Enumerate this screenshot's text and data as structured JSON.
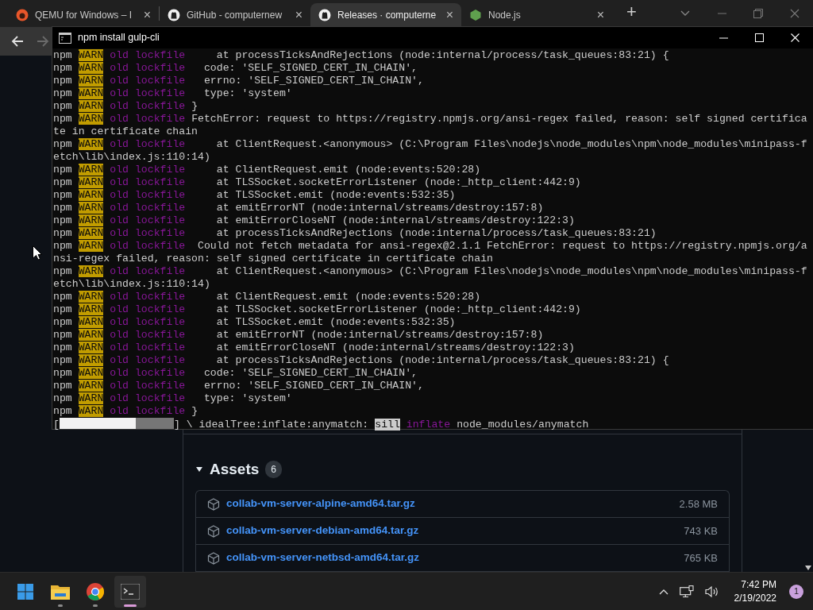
{
  "browser": {
    "tabs": [
      {
        "kind": "qemu",
        "title": "QEMU for Windows – I",
        "close": "×",
        "selected": false
      },
      {
        "kind": "github",
        "title": "GitHub - computernew",
        "close": "×",
        "selected": false
      },
      {
        "kind": "github",
        "title": "Releases · computerne",
        "close": "×",
        "selected": true
      },
      {
        "kind": "node",
        "title": "Node.js",
        "close": "×",
        "selected": false
      }
    ],
    "new_tab": "+",
    "nav_buttons": [
      {
        "kind": "back",
        "disabled": false
      },
      {
        "kind": "forward",
        "disabled": true
      }
    ]
  },
  "page": {
    "assets": {
      "title": "Assets",
      "count": "6",
      "expanded": true,
      "files": [
        {
          "name": "collab-vm-server-alpine-amd64.tar.gz",
          "size": "2.58 MB"
        },
        {
          "name": "collab-vm-server-debian-amd64.tar.gz",
          "size": "743 KB"
        },
        {
          "name": "collab-vm-server-netbsd-amd64.tar.gz",
          "size": "765 KB"
        }
      ]
    }
  },
  "terminal": {
    "title": "npm install gulp-cli",
    "lines": [
      {
        "kind": "warn",
        "tool": "npm",
        "level": "WARN",
        "tag": "old lockfile",
        "text": "     at processTicksAndRejections (node:internal/process/task_queues:83:21) {"
      },
      {
        "kind": "warn",
        "tool": "npm",
        "level": "WARN",
        "tag": "old lockfile",
        "text": "   code: 'SELF_SIGNED_CERT_IN_CHAIN',"
      },
      {
        "kind": "warn",
        "tool": "npm",
        "level": "WARN",
        "tag": "old lockfile",
        "text": "   errno: 'SELF_SIGNED_CERT_IN_CHAIN',"
      },
      {
        "kind": "warn",
        "tool": "npm",
        "level": "WARN",
        "tag": "old lockfile",
        "text": "   type: 'system'"
      },
      {
        "kind": "warn",
        "tool": "npm",
        "level": "WARN",
        "tag": "old lockfile",
        "text": " }"
      },
      {
        "kind": "warn",
        "tool": "npm",
        "level": "WARN",
        "tag": "old lockfile",
        "text": " FetchError: request to https://registry.npmjs.org/ansi-regex failed, reason: self signed certifica"
      },
      {
        "kind": "plain",
        "text": "te in certificate chain"
      },
      {
        "kind": "warn",
        "tool": "npm",
        "level": "WARN",
        "tag": "old lockfile",
        "text": "     at ClientRequest.<anonymous> (C:\\Program Files\\nodejs\\node_modules\\npm\\node_modules\\minipass-f"
      },
      {
        "kind": "plain",
        "text": "etch\\lib\\index.js:110:14)"
      },
      {
        "kind": "warn",
        "tool": "npm",
        "level": "WARN",
        "tag": "old lockfile",
        "text": "     at ClientRequest.emit (node:events:520:28)"
      },
      {
        "kind": "warn",
        "tool": "npm",
        "level": "WARN",
        "tag": "old lockfile",
        "text": "     at TLSSocket.socketErrorListener (node:_http_client:442:9)"
      },
      {
        "kind": "warn",
        "tool": "npm",
        "level": "WARN",
        "tag": "old lockfile",
        "text": "     at TLSSocket.emit (node:events:532:35)"
      },
      {
        "kind": "warn",
        "tool": "npm",
        "level": "WARN",
        "tag": "old lockfile",
        "text": "     at emitErrorNT (node:internal/streams/destroy:157:8)"
      },
      {
        "kind": "warn",
        "tool": "npm",
        "level": "WARN",
        "tag": "old lockfile",
        "text": "     at emitErrorCloseNT (node:internal/streams/destroy:122:3)"
      },
      {
        "kind": "warn",
        "tool": "npm",
        "level": "WARN",
        "tag": "old lockfile",
        "text": "     at processTicksAndRejections (node:internal/process/task_queues:83:21)"
      },
      {
        "kind": "warn",
        "tool": "npm",
        "level": "WARN",
        "tag": "old lockfile",
        "text": "  Could not fetch metadata for ansi-regex@2.1.1 FetchError: request to https://registry.npmjs.org/a"
      },
      {
        "kind": "plain",
        "text": "nsi-regex failed, reason: self signed certificate in certificate chain"
      },
      {
        "kind": "warn",
        "tool": "npm",
        "level": "WARN",
        "tag": "old lockfile",
        "text": "     at ClientRequest.<anonymous> (C:\\Program Files\\nodejs\\node_modules\\npm\\node_modules\\minipass-f"
      },
      {
        "kind": "plain",
        "text": "etch\\lib\\index.js:110:14)"
      },
      {
        "kind": "warn",
        "tool": "npm",
        "level": "WARN",
        "tag": "old lockfile",
        "text": "     at ClientRequest.emit (node:events:520:28)"
      },
      {
        "kind": "warn",
        "tool": "npm",
        "level": "WARN",
        "tag": "old lockfile",
        "text": "     at TLSSocket.socketErrorListener (node:_http_client:442:9)"
      },
      {
        "kind": "warn",
        "tool": "npm",
        "level": "WARN",
        "tag": "old lockfile",
        "text": "     at TLSSocket.emit (node:events:532:35)"
      },
      {
        "kind": "warn",
        "tool": "npm",
        "level": "WARN",
        "tag": "old lockfile",
        "text": "     at emitErrorNT (node:internal/streams/destroy:157:8)"
      },
      {
        "kind": "warn",
        "tool": "npm",
        "level": "WARN",
        "tag": "old lockfile",
        "text": "     at emitErrorCloseNT (node:internal/streams/destroy:122:3)"
      },
      {
        "kind": "warn",
        "tool": "npm",
        "level": "WARN",
        "tag": "old lockfile",
        "text": "     at processTicksAndRejections (node:internal/process/task_queues:83:21) {"
      },
      {
        "kind": "warn",
        "tool": "npm",
        "level": "WARN",
        "tag": "old lockfile",
        "text": "   code: 'SELF_SIGNED_CERT_IN_CHAIN',"
      },
      {
        "kind": "warn",
        "tool": "npm",
        "level": "WARN",
        "tag": "old lockfile",
        "text": "   errno: 'SELF_SIGNED_CERT_IN_CHAIN',"
      },
      {
        "kind": "warn",
        "tool": "npm",
        "level": "WARN",
        "tag": "old lockfile",
        "text": "   type: 'system'"
      },
      {
        "kind": "warn",
        "tool": "npm",
        "level": "WARN",
        "tag": "old lockfile",
        "text": " }"
      },
      {
        "kind": "progress",
        "open": "[",
        "level": 0.67,
        "close": "]",
        "spinner": "\\",
        "stage": "idealTree:inflate:anymatch:",
        "log_level": "sill",
        "tag": "inflate",
        "text": "node_modules/anymatch"
      }
    ]
  },
  "taskbar": {
    "apps": [
      {
        "kind": "start",
        "running": false,
        "selected": false
      },
      {
        "kind": "explorer",
        "running": true,
        "selected": false
      },
      {
        "kind": "chrome",
        "running": true,
        "selected": false
      },
      {
        "kind": "terminal",
        "running": true,
        "selected": true
      }
    ],
    "time": "7:42 PM",
    "date": "2/19/2022",
    "notifications": "1"
  }
}
